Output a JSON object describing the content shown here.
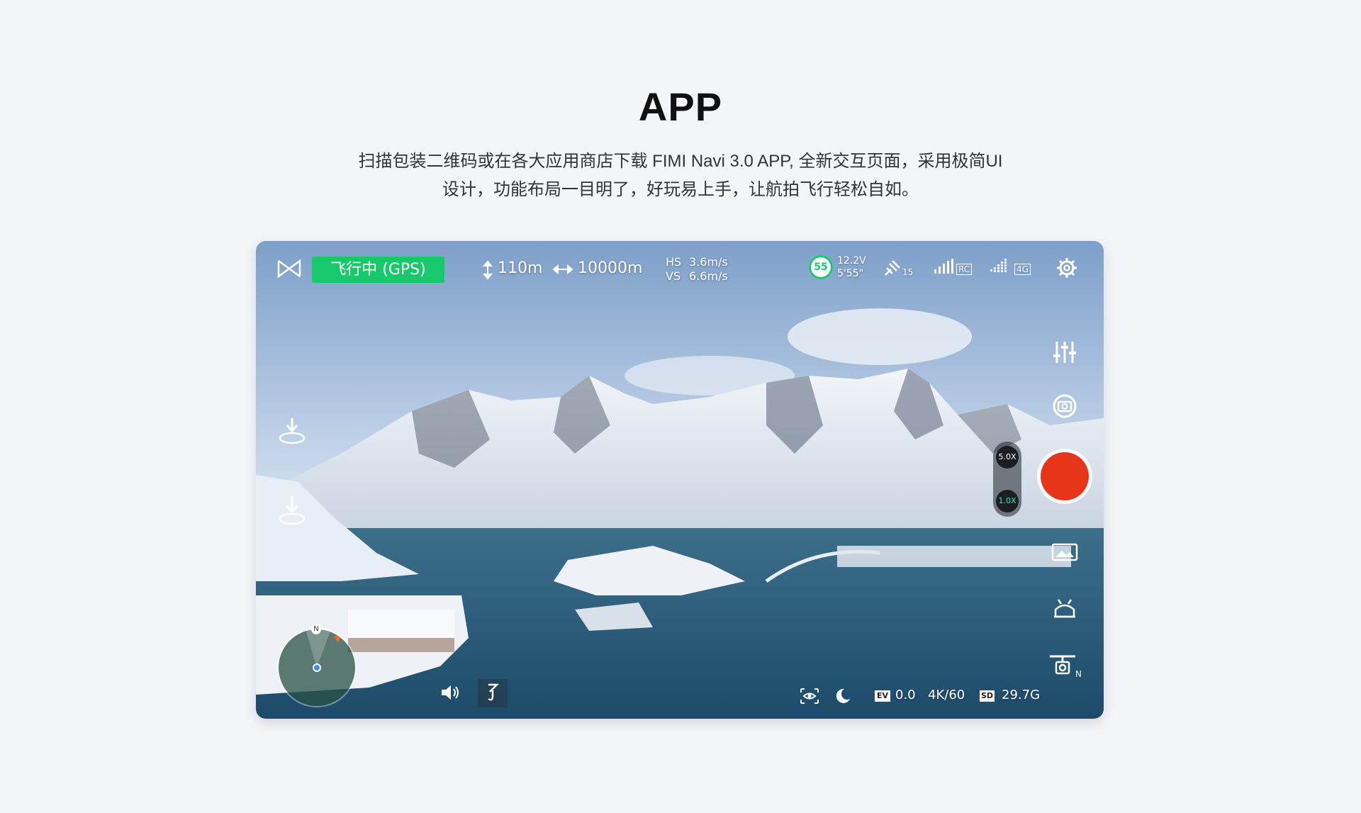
{
  "page": {
    "title": "APP",
    "subtitle_line1": "扫描包装二维码或在各大应用商店下载 FIMI Navi 3.0 APP, 全新交互页面，采用极简UI",
    "subtitle_line2": "设计，功能布局一目明了，好玩易上手，让航拍飞行轻松自如。"
  },
  "hud": {
    "flight_status": "飞行中 (GPS)",
    "altitude": "110m",
    "distance": "10000m",
    "hs_label": "HS",
    "hs_value": "3.6m/s",
    "vs_label": "VS",
    "vs_value": "6.6m/s",
    "battery_percent": "55",
    "voltage": "12.2V",
    "flight_time": "5'55\"",
    "satellites": "15",
    "rc_label": "RC",
    "net_label": "4G"
  },
  "camera": {
    "zoom_high": "5.0X",
    "zoom_low": "1.0X",
    "ev_label": "EV",
    "ev_value": "0.0",
    "resolution": "4K/60",
    "sd_label": "SD",
    "sd_free": "29.7G"
  },
  "radar": {
    "north_label": "N"
  },
  "gimbal": {
    "north_label": "N"
  },
  "colors": {
    "status_green": "#18c96b",
    "record_red": "#e73519",
    "background": "#f4f5f8"
  },
  "icons": [
    "fimi-logo-icon",
    "altitude-icon",
    "distance-icon",
    "battery-ring-icon",
    "satellite-icon",
    "rc-signal-icon",
    "4g-signal-icon",
    "settings-gear-icon",
    "adjust-sliders-icon",
    "camera-mode-icon",
    "gallery-icon",
    "drone-icon",
    "gimbal-icon",
    "takeoff-icon",
    "landing-icon",
    "speaker-icon",
    "hook-icon",
    "eye-icon",
    "night-mode-icon",
    "ev-icon",
    "sd-card-icon"
  ]
}
